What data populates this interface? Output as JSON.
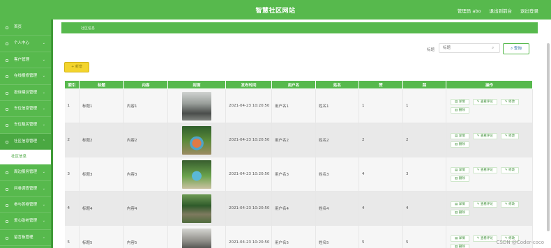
{
  "topbar": {
    "title": "智慧社区网站",
    "admin": "管理员 abo",
    "back_front": "退出到前台",
    "logout": "退出登录"
  },
  "sidebar": {
    "items": [
      {
        "label": "首页",
        "chev": ""
      },
      {
        "label": "个人中心",
        "chev": "⌄"
      },
      {
        "label": "客户管理",
        "chev": "⌄"
      },
      {
        "label": "在线报修管理",
        "chev": "⌄"
      },
      {
        "label": "投诉建议管理",
        "chev": "⌄"
      },
      {
        "label": "车位信息管理",
        "chev": "⌄"
      },
      {
        "label": "车位租买管理",
        "chev": "⌄"
      },
      {
        "label": "社区信息管理",
        "chev": "⌃"
      },
      {
        "label": "社区信息",
        "chev": ""
      },
      {
        "label": "周边服务管理",
        "chev": "⌄"
      },
      {
        "label": "问卷调查管理",
        "chev": "⌄"
      },
      {
        "label": "参与答卷管理",
        "chev": "⌄"
      },
      {
        "label": "爱心助老管理",
        "chev": "⌄"
      },
      {
        "label": "留言板管理",
        "chev": "⌄"
      }
    ]
  },
  "breadcrumb": "社区信息",
  "search": {
    "label": "标题",
    "placeholder": "标题",
    "button": "查询"
  },
  "add_button": "新增",
  "table": {
    "headers": [
      "索引",
      "标题",
      "内容",
      "封面",
      "发布时间",
      "用户名",
      "姓名",
      "赞",
      "踩",
      "操作"
    ],
    "rows": [
      {
        "index": "1",
        "title": "标题1",
        "content": "内容1",
        "time": "2021-04-23 10:20:50",
        "user": "用户名1",
        "name": "姓名1",
        "like": "1",
        "dislike": "1"
      },
      {
        "index": "2",
        "title": "标题2",
        "content": "内容2",
        "time": "2021-04-23 10:20:50",
        "user": "用户名2",
        "name": "姓名2",
        "like": "2",
        "dislike": "2"
      },
      {
        "index": "3",
        "title": "标题3",
        "content": "内容3",
        "time": "2021-04-23 10:20:50",
        "user": "用户名3",
        "name": "姓名3",
        "like": "4",
        "dislike": "3"
      },
      {
        "index": "4",
        "title": "标题4",
        "content": "内容4",
        "time": "2021-04-23 10:20:50",
        "user": "用户名4",
        "name": "姓名4",
        "like": "4",
        "dislike": "4"
      },
      {
        "index": "5",
        "title": "标题5",
        "content": "内容5",
        "time": "2021-04-23 10:20:50",
        "user": "用户名5",
        "name": "姓名5",
        "like": "5",
        "dislike": "5"
      }
    ],
    "actions": {
      "detail": "详情",
      "comments": "查看评论",
      "edit": "修改",
      "delete": "删除"
    }
  },
  "watermark": "CSDN @Coder-coco",
  "colors": {
    "primary": "#57b94d",
    "add_button": "#f3d42d"
  }
}
